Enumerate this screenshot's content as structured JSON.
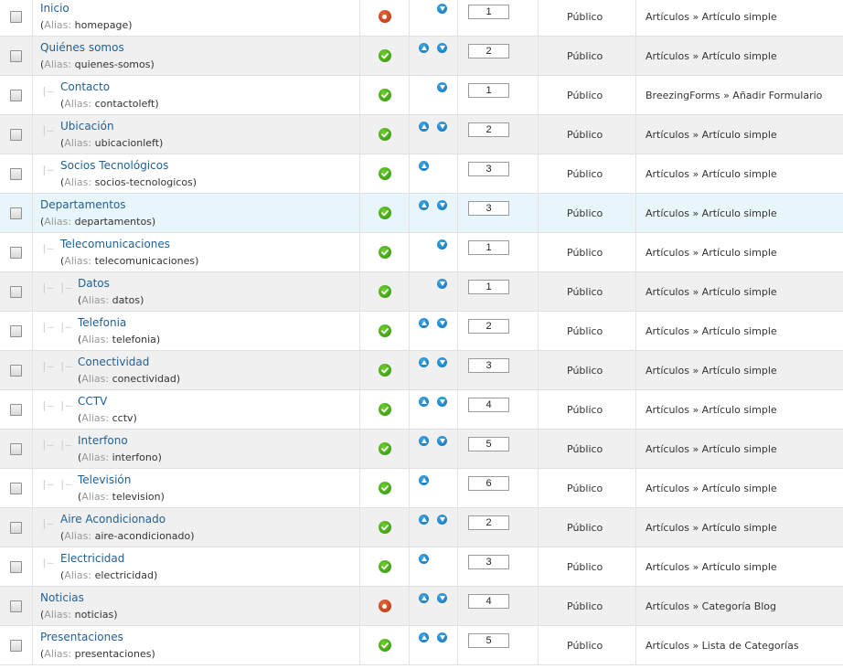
{
  "alias_label": "Alias:",
  "rows": [
    {
      "title": "Inicio",
      "alias": "homepage",
      "level": 0,
      "status": "home",
      "up": false,
      "down": true,
      "order": "1",
      "access": "Público",
      "type": "Artículos » Artículo simple"
    },
    {
      "title": "Quiénes somos",
      "alias": "quienes-somos",
      "level": 0,
      "status": "published",
      "up": true,
      "down": true,
      "order": "2",
      "access": "Público",
      "type": "Artículos » Artículo simple"
    },
    {
      "title": "Contacto",
      "alias": "contactoleft",
      "level": 1,
      "status": "published",
      "up": false,
      "down": true,
      "order": "1",
      "access": "Público",
      "type": "BreezingForms » Añadir Formulario"
    },
    {
      "title": "Ubicación",
      "alias": "ubicacionleft",
      "level": 1,
      "status": "published",
      "up": true,
      "down": true,
      "order": "2",
      "access": "Público",
      "type": "Artículos » Artículo simple"
    },
    {
      "title": "Socios Tecnológicos",
      "alias": "socios-tecnologicos",
      "level": 1,
      "status": "published",
      "up": true,
      "down": false,
      "order": "3",
      "access": "Público",
      "type": "Artículos » Artículo simple"
    },
    {
      "title": "Departamentos",
      "alias": "departamentos",
      "level": 0,
      "status": "published",
      "up": true,
      "down": true,
      "order": "3",
      "access": "Público",
      "type": "Artículos » Artículo simple",
      "highlight": true
    },
    {
      "title": "Telecomunicaciones",
      "alias": "telecomunicaciones",
      "level": 1,
      "status": "published",
      "up": false,
      "down": true,
      "order": "1",
      "access": "Público",
      "type": "Artículos » Artículo simple"
    },
    {
      "title": "Datos",
      "alias": "datos",
      "level": 2,
      "status": "published",
      "up": false,
      "down": true,
      "order": "1",
      "access": "Público",
      "type": "Artículos » Artículo simple"
    },
    {
      "title": "Telefonia",
      "alias": "telefonia",
      "level": 2,
      "status": "published",
      "up": true,
      "down": true,
      "order": "2",
      "access": "Público",
      "type": "Artículos » Artículo simple"
    },
    {
      "title": "Conectividad",
      "alias": "conectividad",
      "level": 2,
      "status": "published",
      "up": true,
      "down": true,
      "order": "3",
      "access": "Público",
      "type": "Artículos » Artículo simple"
    },
    {
      "title": "CCTV",
      "alias": "cctv",
      "level": 2,
      "status": "published",
      "up": true,
      "down": true,
      "order": "4",
      "access": "Público",
      "type": "Artículos » Artículo simple"
    },
    {
      "title": "Interfono",
      "alias": "interfono",
      "level": 2,
      "status": "published",
      "up": true,
      "down": true,
      "order": "5",
      "access": "Público",
      "type": "Artículos » Artículo simple"
    },
    {
      "title": "Televisión",
      "alias": "television",
      "level": 2,
      "status": "published",
      "up": true,
      "down": false,
      "order": "6",
      "access": "Público",
      "type": "Artículos » Artículo simple"
    },
    {
      "title": "Aire Acondicionado",
      "alias": "aire-acondicionado",
      "level": 1,
      "status": "published",
      "up": true,
      "down": true,
      "order": "2",
      "access": "Público",
      "type": "Artículos » Artículo simple"
    },
    {
      "title": "Electricidad",
      "alias": "electricidad",
      "level": 1,
      "status": "published",
      "up": true,
      "down": false,
      "order": "3",
      "access": "Público",
      "type": "Artículos » Artículo simple"
    },
    {
      "title": "Noticias",
      "alias": "noticias",
      "level": 0,
      "status": "home",
      "up": true,
      "down": true,
      "order": "4",
      "access": "Público",
      "type": "Artículos » Categoría Blog"
    },
    {
      "title": "Presentaciones",
      "alias": "presentaciones",
      "level": 0,
      "status": "published",
      "up": true,
      "down": true,
      "order": "5",
      "access": "Público",
      "type": "Artículos » Lista de Categorías"
    }
  ],
  "icons": {
    "status_published": "check-circle-icon",
    "status_home": "home-default-icon",
    "order_up": "arrow-up-icon",
    "order_down": "arrow-down-icon"
  },
  "colors": {
    "link": "#1f5f93",
    "published": "#3a9a12",
    "home": "#c93c12",
    "order_arrow": "#1a86cf",
    "row_alt": "#f0f0f0",
    "row_highlight": "#e8f6fb"
  }
}
